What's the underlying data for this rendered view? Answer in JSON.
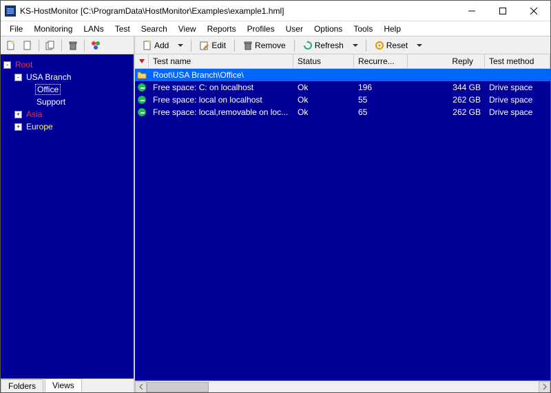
{
  "window": {
    "title": "KS-HostMonitor  [C:\\ProgramData\\HostMonitor\\Examples\\example1.hml]"
  },
  "menu": {
    "items": [
      "File",
      "Monitoring",
      "LANs",
      "Test",
      "Search",
      "View",
      "Reports",
      "Profiles",
      "User",
      "Options",
      "Tools",
      "Help"
    ]
  },
  "left_toolbar": {
    "icons": [
      "new-file-icon",
      "page-icon",
      "copy-icon",
      "delete-icon",
      "palette-icon"
    ]
  },
  "tree": {
    "root_label": "Root",
    "root_expanded": "-",
    "nodes": [
      {
        "exp": "-",
        "label": "USA Branch",
        "cls": "lbl-norm",
        "children": [
          {
            "label": "Office",
            "cls": "lbl-sel"
          },
          {
            "label": "Support",
            "cls": "lbl-norm"
          }
        ]
      },
      {
        "exp": "+",
        "label": "Asia",
        "cls": "lbl-root"
      },
      {
        "exp": "+",
        "label": "Europe",
        "cls": "lbl-yellow"
      }
    ]
  },
  "bottom_tabs": {
    "folders": "Folders",
    "views": "Views"
  },
  "main_toolbar": {
    "add": "Add",
    "edit": "Edit",
    "remove": "Remove",
    "refresh": "Refresh",
    "reset": "Reset"
  },
  "columns": {
    "name": "Test name",
    "status": "Status",
    "recur": "Recurre...",
    "reply": "Reply",
    "method": "Test method"
  },
  "rows": [
    {
      "selected": true,
      "icon": "folder-open-icon",
      "name": "Root\\USA Branch\\Office\\",
      "status": "",
      "recur": "",
      "reply": "",
      "method": ""
    },
    {
      "icon": "status-ok-icon",
      "name": "Free space: C: on localhost",
      "status": "Ok",
      "recur": "196",
      "reply": "344 GB",
      "method": "Drive space"
    },
    {
      "icon": "status-ok-icon",
      "name": "Free space: local on localhost",
      "status": "Ok",
      "recur": "55",
      "reply": "262 GB",
      "method": "Drive space"
    },
    {
      "icon": "status-ok-icon",
      "name": "Free space: local,removable on loc...",
      "status": "Ok",
      "recur": "65",
      "reply": "262 GB",
      "method": "Drive space"
    }
  ]
}
